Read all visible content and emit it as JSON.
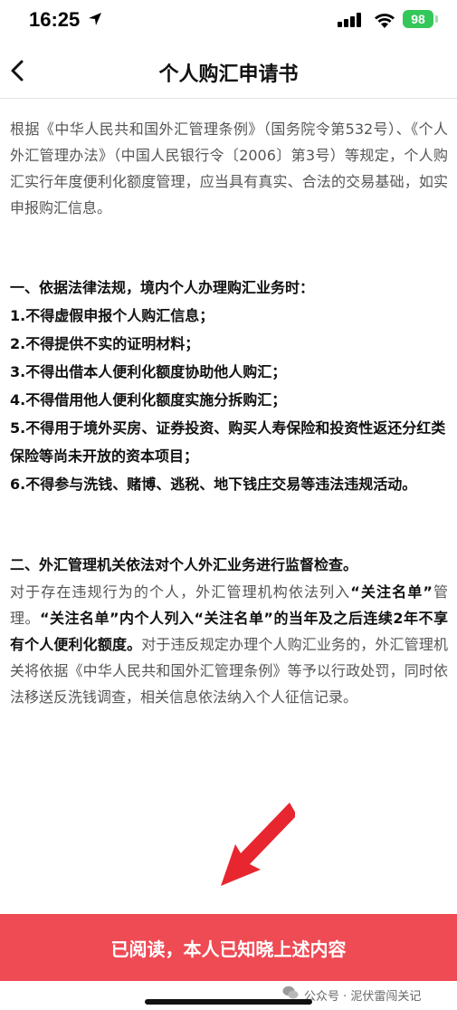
{
  "status_bar": {
    "time": "16:25",
    "battery": "98"
  },
  "nav": {
    "title": "个人购汇申请书"
  },
  "intro": "根据《中华人民共和国外汇管理条例》（国务院令第532号）、《个人外汇管理办法》（中国人民银行令〔2006〕第3号）等规定，个人购汇实行年度便利化额度管理，应当具有真实、合法的交易基础，如实申报购汇信息。",
  "section1": {
    "title": "一、依据法律法规，境内个人办理购汇业务时：",
    "items": [
      "1.不得虚假申报个人购汇信息；",
      "2.不得提供不实的证明材料；",
      "3.不得出借本人便利化额度协助他人购汇；",
      "4.不得借用他人便利化额度实施分拆购汇；",
      "5.不得用于境外买房、证券投资、购买人寿保险和投资性返还分红类保险等尚未开放的资本项目；",
      "6.不得参与洗钱、赌博、逃税、地下钱庄交易等违法违规活动。"
    ]
  },
  "section2": {
    "title": "二、外汇管理机关依法对个人外汇业务进行监督检查。",
    "text_a": "对于存在违规行为的个人，外汇管理机构依法列入",
    "bold_a": "“关注名单”",
    "text_b": "管理。",
    "bold_b": "“关注名单”内个人列入“关注名单”的当年及之后连续2年不享有个人便利化额度。",
    "text_c": "对于违反规定办理个人购汇业务的，外汇管理机关将依据《中华人民共和国外汇管理条例》等予以行政处罚，同时依法移送反洗钱调查，相关信息依法纳入个人征信记录。"
  },
  "confirm_button": "已阅读，本人已知晓上述内容",
  "watermark": "公众号 · 泥伏雷闯关记",
  "colors": {
    "accent": "#ef4b55",
    "arrow": "#e8262f",
    "battery": "#34c759"
  }
}
